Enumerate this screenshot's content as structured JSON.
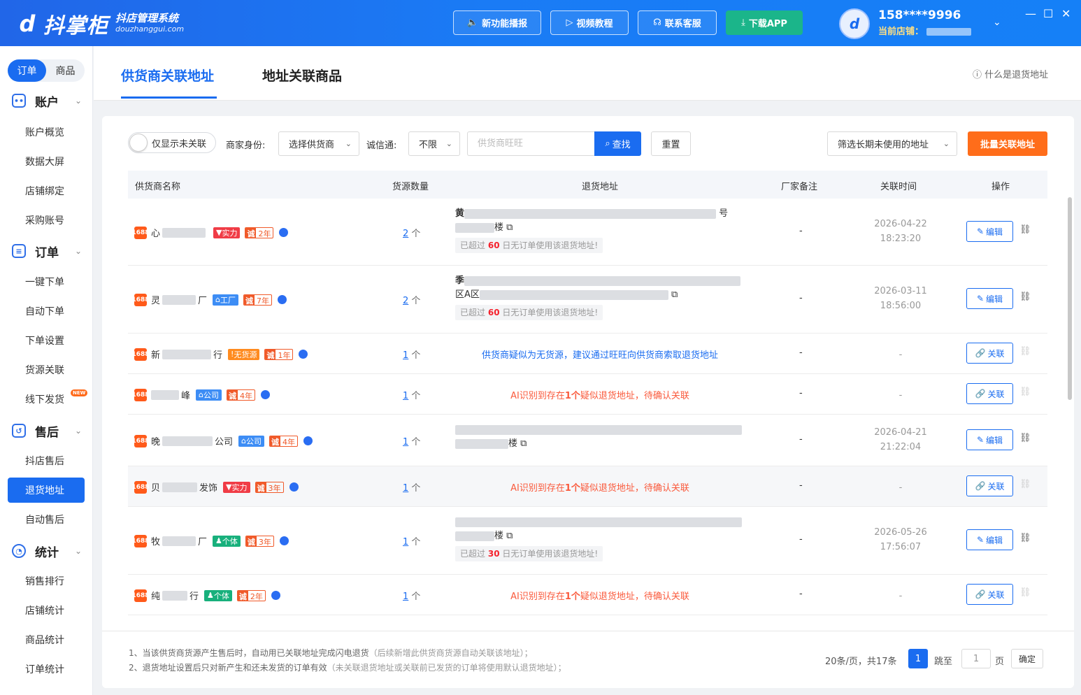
{
  "topbar": {
    "logo_name": "抖掌柜",
    "logo_subtitle": "抖店管理系统",
    "logo_domain": "douzhanggui.com",
    "buttons": [
      "新功能播报",
      "视频教程",
      "联系客服",
      "下载APP"
    ],
    "user_phone": "158****9996",
    "current_shop_label": "当前店铺："
  },
  "sidebar": {
    "segments": [
      "订单",
      "商品"
    ],
    "groups": [
      {
        "label": "账户",
        "items": [
          "账户概览",
          "数据大屏",
          "店铺绑定",
          "采购账号"
        ]
      },
      {
        "label": "订单",
        "items": [
          "一键下单",
          "自动下单",
          "下单设置",
          "货源关联",
          "线下发货"
        ]
      },
      {
        "label": "售后",
        "items": [
          "抖店售后",
          "退货地址",
          "自动售后"
        ]
      },
      {
        "label": "统计",
        "items": [
          "销售排行",
          "店铺统计",
          "商品统计",
          "订单统计"
        ]
      }
    ],
    "new_tag": "NEW",
    "active_item": "退货地址"
  },
  "tabs": {
    "items": [
      "供货商关联地址",
      "地址关联商品"
    ],
    "active": "供货商关联地址",
    "help": "什么是退货地址"
  },
  "filters": {
    "toggle_label": "仅显示未关联",
    "identity_label": "商家身份:",
    "identity_value": "选择供货商",
    "cxt_label": "诚信通:",
    "cxt_value": "不限",
    "search_placeholder": "供货商旺旺",
    "search_button": "查找",
    "reset_button": "重置",
    "unused_filter": "筛选长期未使用的地址",
    "batch_button": "批量关联地址"
  },
  "table": {
    "headers": [
      "供货商名称",
      "货源数量",
      "退货地址",
      "厂家备注",
      "关联时间",
      "操作"
    ],
    "rows": [
      {
        "name_prefix": "心",
        "name_suffix": "",
        "badge": "实力",
        "badge_color": "#f03c46",
        "years": "2年",
        "count_num": "2",
        "count_unit": "个",
        "addr_line1": "黄",
        "addr_line1_tail": "号",
        "addr_line2": "楼",
        "warn_pre": "已超过",
        "warn_days": "60",
        "warn_post": "日无订单使用该退货地址!",
        "note": "-",
        "date": "2026-04-22",
        "time": "18:23:20",
        "op": "编辑"
      },
      {
        "name_prefix": "灵",
        "name_suffix": "厂",
        "badge": "工厂",
        "badge_color": "#3d8df5",
        "years": "7年",
        "count_num": "2",
        "count_unit": "个",
        "addr_line1": "季",
        "addr_line1_tail": "",
        "addr_line2": "区A区",
        "warn_pre": "已超过",
        "warn_days": "60",
        "warn_post": "日无订单使用该退货地址!",
        "note": "-",
        "date": "2026-03-11",
        "time": "18:56:00",
        "op": "编辑"
      },
      {
        "name_prefix": "新",
        "name_suffix": "行",
        "badge": "无货源",
        "badge_color": "#ff8b1f",
        "years": "1年",
        "count_num": "1",
        "count_unit": "个",
        "tip": "供货商疑似为无货源，建议通过旺旺向供货商索取退货地址",
        "note": "-",
        "date": "-",
        "op": "关联"
      },
      {
        "name_prefix": "",
        "name_suffix": "峰",
        "badge": "公司",
        "badge_color": "#3d8df5",
        "years": "4年",
        "count_num": "1",
        "count_unit": "个",
        "ai_pre": "AI识别到存在",
        "ai_bold": "1个",
        "ai_post": "疑似退货地址，待确认关联",
        "note": "-",
        "date": "-",
        "op": "关联"
      },
      {
        "name_prefix": "晚",
        "name_suffix": "公司",
        "badge": "公司",
        "badge_color": "#3d8df5",
        "years": "4年",
        "count_num": "1",
        "count_unit": "个",
        "addr_line1": "",
        "addr_line1_tail": "",
        "addr_line2": "楼",
        "note": "-",
        "date": "2026-04-21",
        "time": "21:22:04",
        "op": "编辑"
      },
      {
        "name_prefix": "贝",
        "name_suffix": "发饰",
        "badge": "实力",
        "badge_color": "#f03c46",
        "years": "3年",
        "count_num": "1",
        "count_unit": "个",
        "ai_pre": "AI识别到存在",
        "ai_bold": "1个",
        "ai_post": "疑似退货地址，待确认关联",
        "note": "-",
        "date": "-",
        "op": "关联"
      },
      {
        "name_prefix": "牧",
        "name_suffix": "厂",
        "badge": "个体",
        "badge_color": "#18b07c",
        "years": "3年",
        "count_num": "1",
        "count_unit": "个",
        "addr_line1": "",
        "addr_line1_tail": "",
        "addr_line2": "楼",
        "warn_pre": "已超过",
        "warn_days": "30",
        "warn_post": "日无订单使用该退货地址!",
        "note": "-",
        "date": "2026-05-26",
        "time": "17:56:07",
        "op": "编辑"
      },
      {
        "name_prefix": "纯",
        "name_suffix": "行",
        "badge": "个体",
        "badge_color": "#18b07c",
        "years": "2年",
        "count_num": "1",
        "count_unit": "个",
        "ai_pre": "AI识别到存在",
        "ai_bold": "1个",
        "ai_post": "疑似退货地址，待确认关联",
        "note": "-",
        "date": "-",
        "op": "关联"
      }
    ]
  },
  "footer": {
    "note1": "1、当该供货商货源产生售后时，自动用已关联地址完成闪电退货",
    "note1_gray": "（后续新增此供货商货源自动关联该地址）；",
    "note2": "2、退货地址设置后只对新产生和还未发货的订单有效",
    "note2_gray": "（未关联退货地址或关联前已发货的订单将使用默认退货地址）；",
    "pager_info": "20条/页，共17条",
    "current_page": "1",
    "jump_label": "跳至",
    "jump_value": "1",
    "page_label": "页",
    "confirm": "确定"
  },
  "colors": {
    "primary": "#1a6cf0",
    "orange": "#ff6d1a",
    "warn_red": "#f5222d",
    "ai_orange": "#fa5a3c"
  }
}
